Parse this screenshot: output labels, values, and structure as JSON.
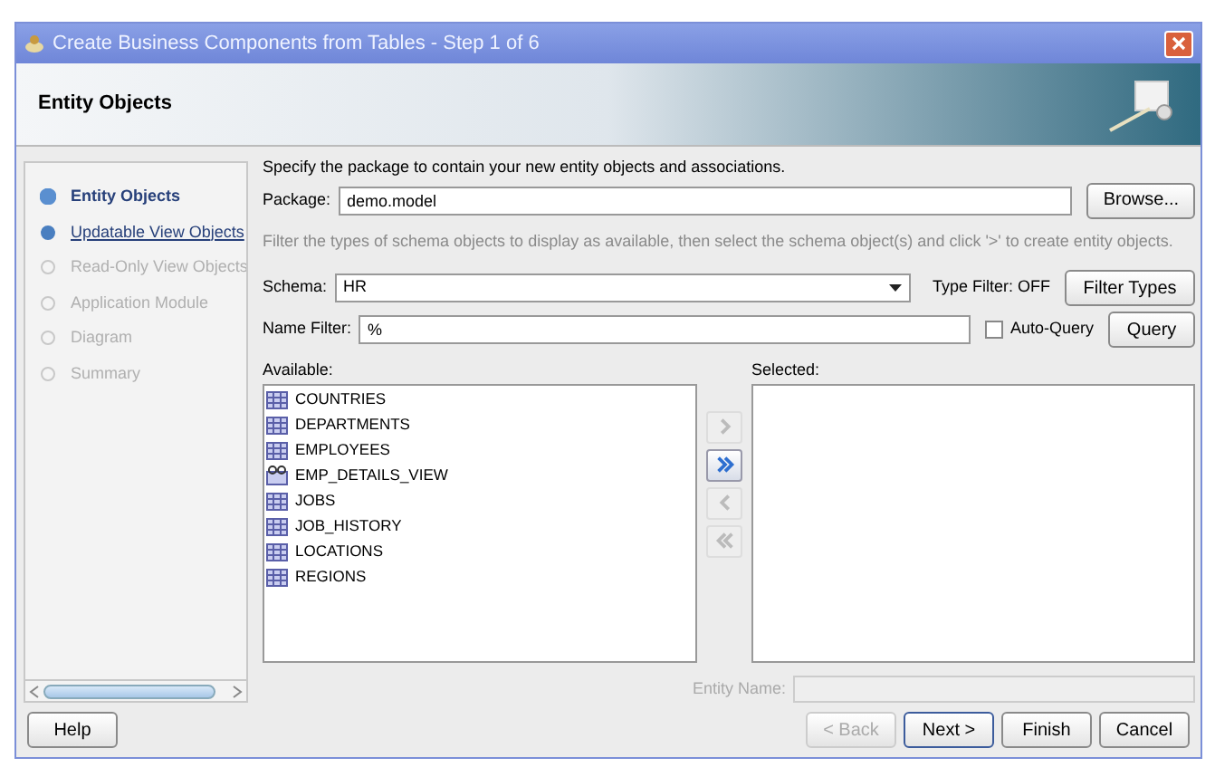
{
  "window": {
    "title": "Create Business Components from Tables - Step 1 of 6"
  },
  "header": {
    "title": "Entity Objects"
  },
  "steps": [
    {
      "label": "Entity Objects",
      "current": true,
      "disabled": false
    },
    {
      "label": "Updatable View Objects",
      "current": false,
      "disabled": false
    },
    {
      "label": "Read-Only View Objects",
      "current": false,
      "disabled": true
    },
    {
      "label": "Application Module",
      "current": false,
      "disabled": true
    },
    {
      "label": "Diagram",
      "current": false,
      "disabled": true
    },
    {
      "label": "Summary",
      "current": false,
      "disabled": true
    }
  ],
  "intro": "Specify the package to contain your new entity objects and associations.",
  "package": {
    "label": "Package:",
    "value": "demo.model",
    "button": "Browse..."
  },
  "filter_hint": "Filter the types of schema objects to display as available, then select the schema object(s) and click '>' to create entity objects.",
  "schema": {
    "label": "Schema:",
    "value": "HR",
    "type_filter": "Type Filter: OFF",
    "button": "Filter Types"
  },
  "name_filter": {
    "label": "Name Filter:",
    "value": "%",
    "auto_query": {
      "label": "Auto-Query",
      "checked": false
    },
    "button": "Query"
  },
  "available": {
    "label": "Available:",
    "items": [
      {
        "name": "COUNTRIES",
        "kind": "table"
      },
      {
        "name": "DEPARTMENTS",
        "kind": "table"
      },
      {
        "name": "EMPLOYEES",
        "kind": "table"
      },
      {
        "name": "EMP_DETAILS_VIEW",
        "kind": "view"
      },
      {
        "name": "JOBS",
        "kind": "table"
      },
      {
        "name": "JOB_HISTORY",
        "kind": "table"
      },
      {
        "name": "LOCATIONS",
        "kind": "table"
      },
      {
        "name": "REGIONS",
        "kind": "table"
      }
    ]
  },
  "shuttle": [
    {
      "kind": "add",
      "disabled": true
    },
    {
      "kind": "add_all",
      "disabled": false
    },
    {
      "kind": "remove",
      "disabled": true
    },
    {
      "kind": "remove_all",
      "disabled": true
    }
  ],
  "selected": {
    "label": "Selected:"
  },
  "entity_name": {
    "label": "Entity Name:",
    "disabled": true
  },
  "buttons": {
    "help": "Help",
    "nav": [
      {
        "label": "< Back",
        "disabled": true,
        "default": false
      },
      {
        "label": "Next >",
        "disabled": false,
        "default": true
      },
      {
        "label": "Finish",
        "disabled": false,
        "default": false
      },
      {
        "label": "Cancel",
        "disabled": false,
        "default": false
      }
    ]
  }
}
